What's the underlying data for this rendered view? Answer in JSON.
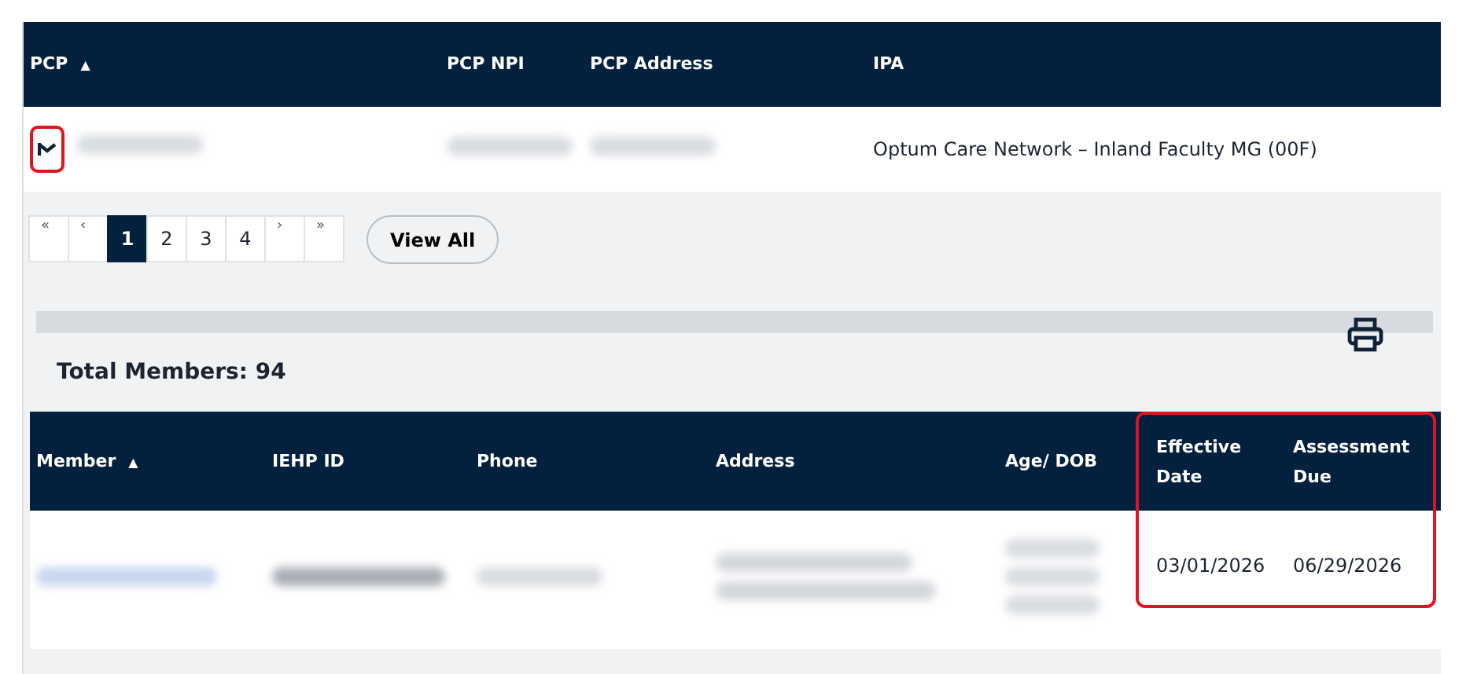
{
  "pcp_table": {
    "columns": [
      {
        "label": "PCP",
        "sort_icon": "▲"
      },
      {
        "label": "PCP NPI"
      },
      {
        "label": "PCP Address"
      },
      {
        "label": "IPA"
      }
    ],
    "rows": [
      {
        "expand_highlighted": true,
        "cells": [
          {
            "kind": "blurred"
          },
          {
            "kind": "blurred"
          },
          {
            "kind": "blurred"
          },
          {
            "kind": "text",
            "text": "Optum Care Network – Inland Faculty MG (00F)"
          }
        ]
      }
    ]
  },
  "pagination": {
    "pages": [
      {
        "label": "«",
        "kind": "nav",
        "selected": false
      },
      {
        "label": "‹",
        "kind": "nav",
        "selected": false
      },
      {
        "label": "1",
        "kind": "page",
        "selected": true
      },
      {
        "label": "2",
        "kind": "page",
        "selected": false
      },
      {
        "label": "3",
        "kind": "page",
        "selected": false
      },
      {
        "label": "4",
        "kind": "page",
        "selected": false
      },
      {
        "label": "›",
        "kind": "nav",
        "selected": false
      },
      {
        "label": "»",
        "kind": "nav",
        "selected": false
      }
    ],
    "view_all": "View All"
  },
  "total_members": "Total Members: 94",
  "members_table": {
    "columns": [
      {
        "label": "Member",
        "sort_icon": "▲",
        "highlighted": false
      },
      {
        "label": "IEHP ID",
        "highlighted": false
      },
      {
        "label": "Phone",
        "highlighted": false
      },
      {
        "label": "Address",
        "highlighted": false
      },
      {
        "label": "Age/ DOB",
        "highlighted": false
      },
      {
        "label": "Effective Date",
        "highlighted": true
      },
      {
        "label": "Assessment Due",
        "highlighted": true
      }
    ],
    "rows": [
      {
        "cells": [
          {
            "kind": "blurred-link"
          },
          {
            "kind": "blurred-dark"
          },
          {
            "kind": "blurred"
          },
          {
            "kind": "blurred-2"
          },
          {
            "kind": "blurred-3"
          },
          {
            "kind": "text",
            "text": "03/01/2026"
          },
          {
            "kind": "text",
            "text": "06/29/2026"
          }
        ]
      }
    ]
  }
}
